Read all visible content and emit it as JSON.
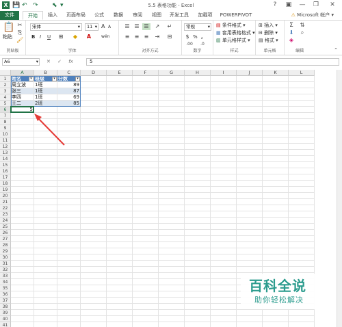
{
  "window": {
    "title": "5.5 表格功能 - Excel",
    "help": "?",
    "minimize": "—",
    "restore": "❐",
    "close": "✕"
  },
  "quick_access": {
    "save": "💾",
    "undo": "↶",
    "redo": "↷",
    "customize": "▾"
  },
  "tabs": [
    "文件",
    "开始",
    "插入",
    "页面布局",
    "公式",
    "数据",
    "审阅",
    "视图",
    "开发工具",
    "加载项",
    "POWERPIVOT"
  ],
  "account": "Microsoft 帐户",
  "ribbon": {
    "clipboard": {
      "paste": "粘贴",
      "label": "剪贴板"
    },
    "font": {
      "name": "宋体",
      "size": "11",
      "grow": "A",
      "shrink": "A",
      "bold": "B",
      "italic": "I",
      "underline": "U",
      "label": "字体",
      "wen": "wén"
    },
    "alignment": {
      "label": "对齐方式"
    },
    "number": {
      "format": "常规",
      "percent": "%",
      "comma": ",",
      "label": "数字"
    },
    "styles": {
      "conditional": "条件格式",
      "table": "套用表格格式",
      "cell": "单元格样式",
      "label": "样式"
    },
    "cells": {
      "insert": "插入",
      "delete": "删除",
      "format": "格式",
      "label": "单元格"
    },
    "editing": {
      "label": "编辑"
    }
  },
  "formula_bar": {
    "name_box": "A6",
    "cancel": "✕",
    "enter": "✓",
    "fx": "fx",
    "value": "5"
  },
  "columns": [
    "A",
    "B",
    "C",
    "D",
    "E",
    "F",
    "G",
    "H",
    "I",
    "J",
    "K",
    "L"
  ],
  "rows": [
    "1",
    "2",
    "3",
    "4",
    "5",
    "6",
    "7",
    "8",
    "9",
    "10",
    "11",
    "12",
    "13",
    "14",
    "15",
    "16",
    "17",
    "18",
    "19",
    "20",
    "21",
    "22",
    "23",
    "24",
    "25",
    "26",
    "27",
    "28",
    "29",
    "30",
    "31",
    "32",
    "33",
    "34",
    "35",
    "36",
    "37",
    "38",
    "39",
    "40",
    "41"
  ],
  "table": {
    "headers": [
      "姓名",
      "班级",
      "分数"
    ],
    "rows": [
      [
        "周立波",
        "1班",
        "89"
      ],
      [
        "张三",
        "1班",
        "87"
      ],
      [
        "李四",
        "1班",
        "69"
      ],
      [
        "王二",
        "2班",
        "85"
      ]
    ],
    "active_value": "5"
  },
  "watermark": {
    "title": "百科全说",
    "subtitle": "助你轻松解决"
  },
  "colors": {
    "excel_green": "#217346",
    "table_header": "#4f81bd",
    "table_band": "#dce6f1",
    "arrow": "#e53935",
    "watermark": "#2c9c8e"
  }
}
